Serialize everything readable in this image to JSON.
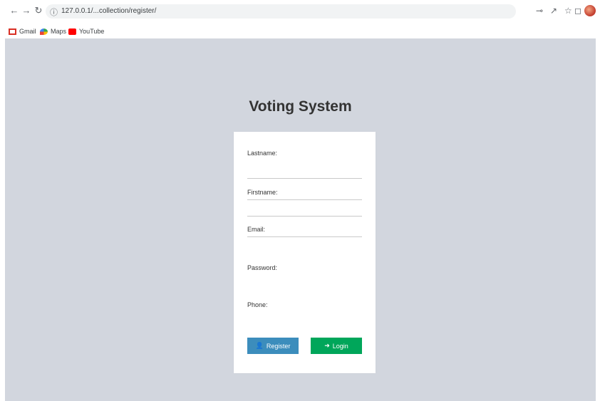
{
  "browser": {
    "url": "127.0.0.1/...collection/register/",
    "bookmarks": [
      {
        "label": "Gmail",
        "icon": "gmail-icon"
      },
      {
        "label": "Maps",
        "icon": "maps-icon"
      },
      {
        "label": "YouTube",
        "icon": "youtube-icon"
      }
    ]
  },
  "page": {
    "title": "Voting System",
    "background_color": "#d2d6de"
  },
  "form": {
    "fields": [
      {
        "label": "Lastname:",
        "value": ""
      },
      {
        "label": "Firstname:",
        "value": ""
      },
      {
        "label": "Email:",
        "value": ""
      },
      {
        "label": "Password:",
        "value": ""
      },
      {
        "label": "Phone:",
        "value": ""
      }
    ],
    "register_label": "Register",
    "login_label": "Login",
    "register_color": "#3c8dbc",
    "login_color": "#00a65a"
  }
}
